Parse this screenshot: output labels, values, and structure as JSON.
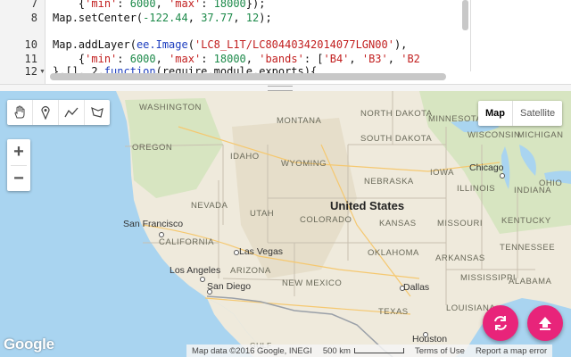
{
  "editor": {
    "gutter": {
      "line_numbers": [
        "7",
        "8",
        "10",
        "11",
        "12"
      ],
      "fold_marker": "▼"
    },
    "lines": [
      {
        "indent": "    ",
        "punct_open": "{",
        "k1": "'min'",
        "sep1": ": ",
        "v1": "6000",
        "sep2": ", ",
        "k2": "'max'",
        "sep3": ": ",
        "v2": "18000",
        "punct_close": "});"
      },
      {
        "obj": "Map",
        "method": ".setCenter(",
        "a1": "-122.44",
        "c1": ", ",
        "a2": "37.77",
        "c2": ", ",
        "a3": "12",
        "end": ");"
      },
      {
        "obj": "Map",
        "method": ".addLayer(",
        "cls": "ee.Image",
        "open": "(",
        "str": "'LC8_L1T/LC80440342014077LGN00'",
        "end": "),"
      },
      {
        "indent": "    ",
        "open": "{",
        "k1": "'min'",
        "s1": ": ",
        "v1": "6000",
        "s2": ", ",
        "k2": "'max'",
        "s3": ": ",
        "v2": "18000",
        "s4": ", ",
        "k3": "'bands'",
        "s5": ": [",
        "b1": "'B4'",
        "s6": ", ",
        "b2": "'B3'",
        "s7": ", ",
        "b3": "'B2"
      },
      {
        "text_a": "},[], 2,",
        "kw": "function",
        "text_b": "(require,module,exports){"
      }
    ]
  },
  "map": {
    "draw_tools": [
      "hand-icon",
      "marker-icon",
      "polyline-icon",
      "polygon-icon"
    ],
    "zoom": {
      "in": "+",
      "out": "−"
    },
    "map_type": {
      "map": "Map",
      "satellite": "Satellite"
    },
    "labels": {
      "washington": "WASHINGTON",
      "oregon": "OREGON",
      "idaho": "IDAHO",
      "montana": "MONTANA",
      "north_dakota": "NORTH DAKOTA",
      "south_dakota": "SOUTH DAKOTA",
      "minnesota": "MINNESOTA",
      "wisconsin": "WISCONSIN",
      "michigan": "MICHIGAN",
      "wyoming": "WYOMING",
      "nebraska": "NEBRASKA",
      "iowa": "IOWA",
      "illinois": "ILLINOIS",
      "indiana": "INDIANA",
      "ohio": "OHIO",
      "nevada": "NEVADA",
      "utah": "UTAH",
      "colorado": "COLORADO",
      "kansas": "KANSAS",
      "missouri": "MISSOURI",
      "kentucky": "KENTUCKY",
      "tennessee": "TENNESSEE",
      "california": "CALIFORNIA",
      "arizona": "ARIZONA",
      "new_mexico": "NEW MEXICO",
      "oklahoma": "OKLAHOMA",
      "arkansas": "ARKANSAS",
      "mississippi": "MISSISSIPPI",
      "alabama": "ALABAMA",
      "texas": "TEXAS",
      "louisiana": "LOUISIANA",
      "united_states": "United States",
      "san_francisco": "San Francisco",
      "las_vegas": "Las Vegas",
      "los_angeles": "Los Angeles",
      "san_diego": "San Diego",
      "dallas": "Dallas",
      "houston": "Houston",
      "chicago": "Chicago",
      "gulf": "Gulf"
    },
    "footer": {
      "logo": "Google",
      "attribution": "Map data ©2016 Google, INEGI",
      "scale": "500 km",
      "terms": "Terms of Use",
      "report": "Report a map error"
    },
    "fabs": [
      "refresh-icon",
      "upload-icon"
    ],
    "colors": {
      "land": "#efeadc",
      "water": "#a9d4f0",
      "mountain": "#e4ddc8",
      "forest": "#cfe3b8",
      "fab": "#e8247a",
      "keyword": "#1c3dbf",
      "string": "#c21f1f",
      "number": "#1d8a4a"
    }
  }
}
